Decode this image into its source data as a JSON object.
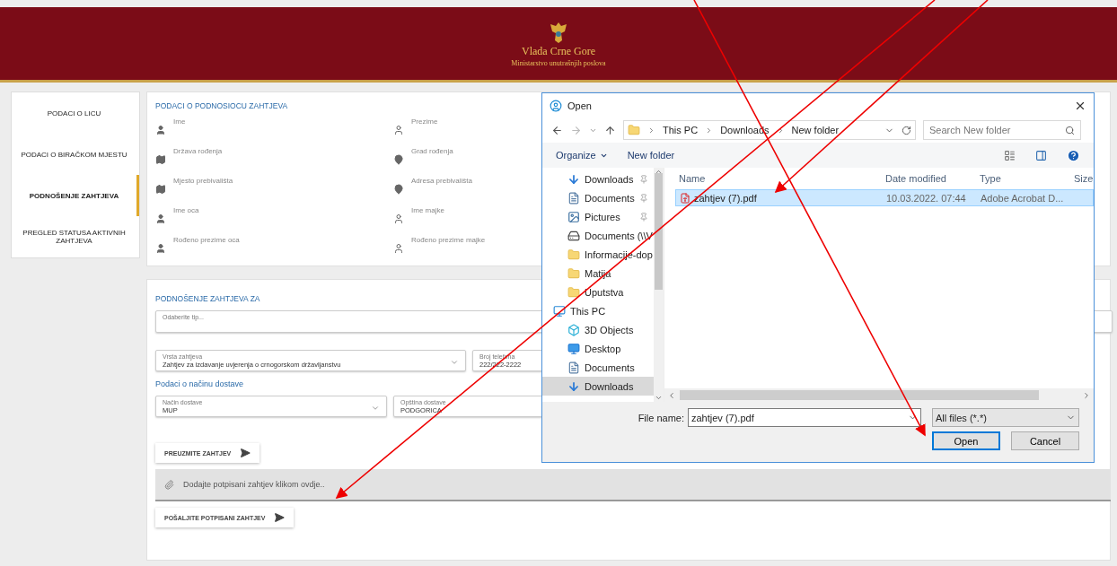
{
  "header": {
    "title": "Vlada Crne Gore",
    "subtitle": "Ministarstvo unutrašnjih poslova"
  },
  "sidebar": {
    "items": [
      {
        "label": "PODACI O LICU",
        "selected": false
      },
      {
        "label": "PODACI O BIRAČKOM MJESTU",
        "selected": false
      },
      {
        "label": "PODNOŠENJE ZAHTJEVA",
        "selected": true
      },
      {
        "label": "PREGLED STATUSA AKTIVNIH ZAHTJEVA",
        "selected": false
      }
    ]
  },
  "applicant": {
    "title": "PODACI O PODNOSIOCU ZAHTJEVA",
    "fields": [
      {
        "label": "Ime",
        "kind": "person"
      },
      {
        "label": "Prezime",
        "kind": "person-outline"
      },
      {
        "label": "Država rođenja",
        "kind": "map"
      },
      {
        "label": "Grad rođenja",
        "kind": "pin"
      },
      {
        "label": "Mjesto prebivališta",
        "kind": "map"
      },
      {
        "label": "Adresa prebivališta",
        "kind": "pin"
      },
      {
        "label": "Ime oca",
        "kind": "person"
      },
      {
        "label": "Ime majke",
        "kind": "person-outline"
      },
      {
        "label": "Rođeno prezime oca",
        "kind": "person"
      },
      {
        "label": "Rođeno prezime majke",
        "kind": "person-outline"
      }
    ]
  },
  "request": {
    "title": "PODNOŠENJE ZAHTJEVA ZA",
    "type_field": {
      "placeholder": "Odaberite tip..."
    },
    "request_kind": {
      "label": "Vrsta zahtjeva",
      "value": "Zahtjev za izdavanje uvjerenja o crnogorskom državljanstvu"
    },
    "phone": {
      "label": "Broj telefona",
      "value": "222/222-2222"
    },
    "delivery_title": "Podaci o načinu dostave",
    "delivery_method": {
      "label": "Način dostave",
      "value": "MUP"
    },
    "delivery_municipality": {
      "label": "Opština dostave",
      "value": "PODGORICA"
    },
    "download_button": "PREUZMITE ZAHTJEV",
    "attach_prompt": "Dodajte potpisani zahtjev klikom ovdje..",
    "send_button": "POŠALJITE POTPISANI ZAHTJEV"
  },
  "dialog": {
    "title": "Open",
    "path": [
      "This PC",
      "Downloads",
      "New folder"
    ],
    "search": {
      "placeholder": "Search New folder"
    },
    "toolbar": [
      "Organize",
      "New folder"
    ],
    "nav_pane": [
      {
        "label": "Downloads",
        "kind": "download",
        "pinned": true,
        "selected": false
      },
      {
        "label": "Documents",
        "kind": "document",
        "pinned": true,
        "selected": false
      },
      {
        "label": "Pictures",
        "kind": "picture",
        "pinned": true,
        "selected": false
      },
      {
        "label": "Documents (\\\\V",
        "kind": "drive",
        "pinned": false,
        "selected": false
      },
      {
        "label": "Informacije-dop",
        "kind": "folder",
        "pinned": false,
        "selected": false
      },
      {
        "label": "Matija",
        "kind": "folder",
        "pinned": false,
        "selected": false
      },
      {
        "label": "Uputstva",
        "kind": "folder",
        "pinned": false,
        "selected": false
      },
      {
        "label": "This PC",
        "kind": "pc",
        "pinned": false,
        "selected": false,
        "children": [
          {
            "label": "3D Objects",
            "kind": "cube",
            "pinned": false,
            "selected": false
          },
          {
            "label": "Desktop",
            "kind": "desktop",
            "pinned": false,
            "selected": false
          },
          {
            "label": "Documents",
            "kind": "document",
            "pinned": false,
            "selected": false
          },
          {
            "label": "Downloads",
            "kind": "download",
            "pinned": false,
            "selected": true
          }
        ]
      }
    ],
    "columns": [
      "Name",
      "Date modified",
      "Type",
      "Size"
    ],
    "files": [
      {
        "name": "zahtjev (7).pdf",
        "date": "10.03.2022. 07:44",
        "type": "Adobe Acrobat D...",
        "selected": true
      }
    ],
    "file_name_label": "File name:",
    "file_name": "zahtjev (7).pdf",
    "filter": "All files (*.*)",
    "buttons": [
      {
        "label": "Open",
        "kind": "primary"
      },
      {
        "label": "Cancel",
        "kind": "secondary"
      }
    ]
  }
}
